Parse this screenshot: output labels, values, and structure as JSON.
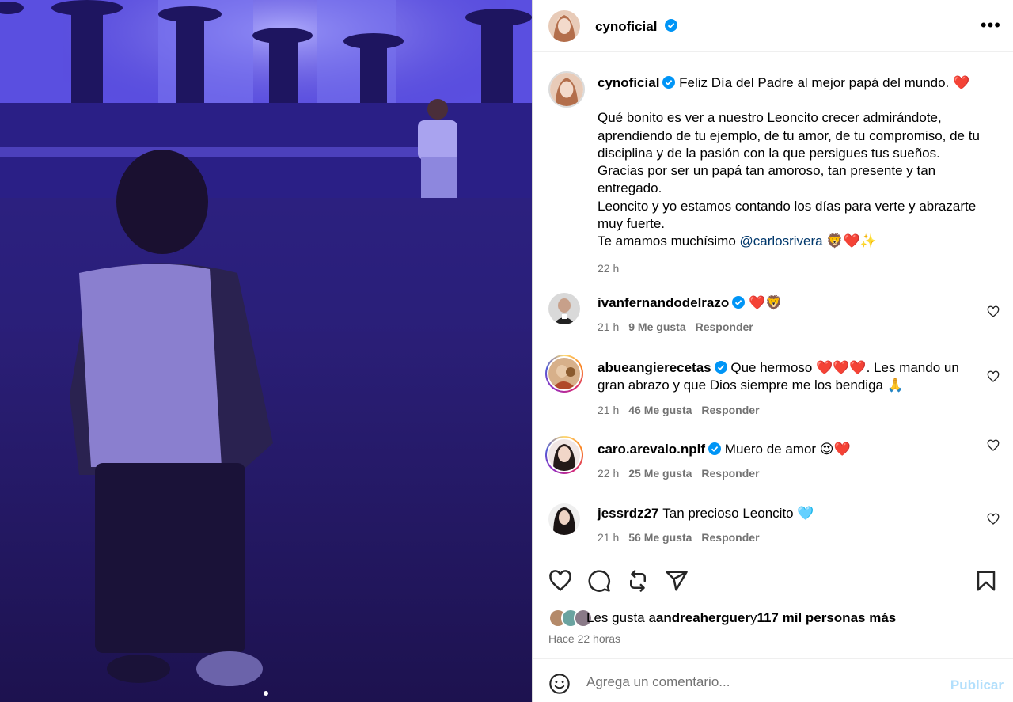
{
  "post": {
    "username": "cynoficial",
    "verified": true,
    "more_icon": "more-horizontal-icon",
    "image_dots": 1
  },
  "caption": {
    "username": "cynoficial",
    "line1": "Feliz Día del Padre al mejor papá del mundo. ❤️",
    "line2": "Qué bonito es ver a nuestro Leoncito crecer admirándote, aprendiendo de tu ejemplo, de tu amor, de tu compromiso, de tu disciplina y de la pasión con la que persigues tus sueños.",
    "line3": "Gracias por ser un papá tan amoroso, tan presente y tan entregado.",
    "line4": "Leoncito y yo estamos contando los días para verte y abrazarte muy fuerte.",
    "line5_prefix": "Te amamos muchísimo ",
    "mention": "@carlosrivera",
    "line5_suffix": " 🦁❤️✨",
    "time": "22 h"
  },
  "comments": [
    {
      "username": "ivanfernandodelrazo",
      "verified": true,
      "text": "❤️🦁",
      "time": "21 h",
      "likes": "9 Me gusta",
      "reply": "Responder"
    },
    {
      "username": "abueangierecetas",
      "verified": true,
      "text": "Que hermoso ❤️❤️❤️. Les mando un gran abrazo y que Dios siempre me los bendiga 🙏",
      "time": "21 h",
      "likes": "46 Me gusta",
      "reply": "Responder"
    },
    {
      "username": "caro.arevalo.nplf",
      "verified": true,
      "text": "Muero de amor 😍❤️",
      "time": "22 h",
      "likes": "25 Me gusta",
      "reply": "Responder"
    },
    {
      "username": "jessrdz27",
      "verified": false,
      "text": "Tan precioso Leoncito 🩵",
      "time": "21 h",
      "likes": "56 Me gusta",
      "reply": "Responder"
    }
  ],
  "actions": {
    "icons": [
      "heart-icon",
      "comment-icon",
      "repost-icon",
      "share-icon",
      "bookmark-icon"
    ],
    "likes_prefix": "Les gusta a ",
    "likes_user": "andreaherguer",
    "likes_middle": " y ",
    "likes_count": "117 mil personas más",
    "ago": "Hace 22 horas"
  },
  "add_comment": {
    "placeholder": "Agrega un comentario...",
    "publish": "Publicar"
  },
  "colors": {
    "verified": "#0095f6",
    "mention": "#00376b",
    "publish_disabled": "#b2dffc",
    "stage_purple": "#3a2fb8"
  }
}
